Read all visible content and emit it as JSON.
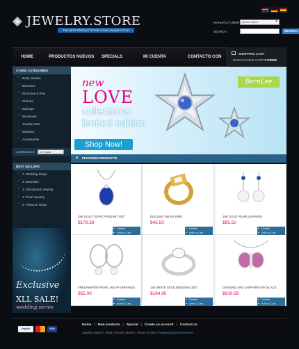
{
  "header": {
    "logo": "JEWELRY.STORE",
    "slogan": "THE BEST PRODUCTS FOR YOUR UNIQUE STYLE",
    "manufacturers_label": "MANUFACTURERS:",
    "manufacturers_value": "please select",
    "search_label": "SEARCH",
    "search_button": "SEARCH"
  },
  "nav": {
    "items": [
      "HOME",
      "PRODUCTOS NUEVOS",
      "SPECIALS",
      "MI CUENTA",
      "CONTACTO CON"
    ],
    "cart_title": "SHOPPING CART",
    "cart_text": "NOW IN YOUR CART",
    "cart_count": "0 ITEMS"
  },
  "sidebar": {
    "categories_title": "STORE CATEGORIES",
    "categories": [
      "Body Jewelry",
      "Bracelets",
      "Brooches & Pins",
      "Charms",
      "Earrings",
      "Necklaces",
      "Jewelry Sets",
      "Watches",
      "Accessories"
    ],
    "currencies_label": "CURRENCIES:",
    "currency_value": "US Dollar",
    "bestsellers_title": "BEST SELLERS",
    "bestsellers": [
      "1. Wedding Rings",
      "2. Bracelets",
      "3. Gemstones Jewelry",
      "4. Pearl Jewelry",
      "5. Platinum Rings"
    ],
    "promo_title": "Exclusive",
    "promo_sale": "XLL SALE!",
    "promo_sub": "wedding series"
  },
  "banner": {
    "new": "new",
    "love": "LOVE",
    "collections": "collections",
    "limited": "limited edition",
    "shop_now": "Shop Now!",
    "brand": "BernLee"
  },
  "featured": {
    "title": "FEATURED PRODUCTS",
    "details_label": "Details",
    "add_label": "Add to Cart",
    "products": [
      {
        "name": "18K GOLD TOPAZ PENDANT SET",
        "price": "$178.59"
      },
      {
        "name": "ELEGANT MEN'S RING",
        "price": "$45.50"
      },
      {
        "name": "18K GOLD PEARL EARRING",
        "price": "$95.50"
      },
      {
        "name": "FRESHWATER PEARL HOOP EARRINGS",
        "price": "$55.00"
      },
      {
        "name": "14K WHITE GOLD WEDDING SET",
        "price": "$184.95"
      },
      {
        "name": "DIAMOND AND SAPPHIRE NECKLACE",
        "price": "$810.58"
      }
    ]
  },
  "footer": {
    "links": [
      "Home",
      "New products",
      "Special",
      "Create an account",
      "Contact us"
    ],
    "copy_prefix": "Jewelry Store © 2009 | Privacy Notice | Terms of Use |",
    "powered": "Powered byosCommerce",
    "pay": [
      "PayPal",
      "MC",
      "VISA"
    ]
  },
  "colors": {
    "accent": "#e2007a",
    "primary": "#2c6c99",
    "bg": "#0a0d12"
  }
}
